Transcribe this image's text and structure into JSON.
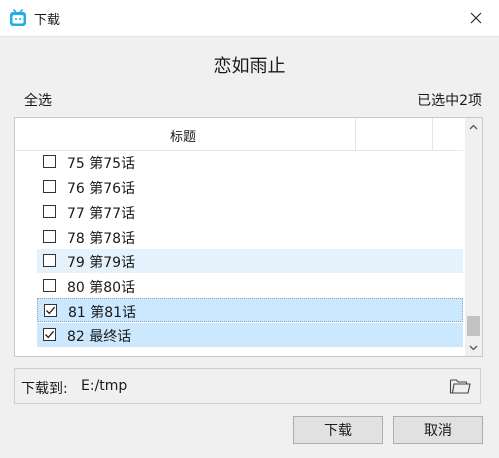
{
  "window": {
    "title": "下载",
    "icon": "bilibili-tv-icon",
    "accent": "#23ade5"
  },
  "heading": "恋如雨止",
  "toolbar": {
    "select_all": "全选",
    "selected_count": "已选中2项"
  },
  "list": {
    "column_title": "标题",
    "rows": [
      {
        "label": "75 第75话",
        "checked": false,
        "state": "normal"
      },
      {
        "label": "76 第76话",
        "checked": false,
        "state": "normal"
      },
      {
        "label": "77 第77话",
        "checked": false,
        "state": "normal"
      },
      {
        "label": "78 第78话",
        "checked": false,
        "state": "normal"
      },
      {
        "label": "79 第79话",
        "checked": false,
        "state": "hover"
      },
      {
        "label": "80 第80话",
        "checked": false,
        "state": "normal"
      },
      {
        "label": "81 第81话",
        "checked": true,
        "state": "selected-focused"
      },
      {
        "label": "82 最终话",
        "checked": true,
        "state": "selected"
      }
    ]
  },
  "path": {
    "label": "下载到:",
    "value": "E:/tmp"
  },
  "buttons": {
    "download": "下载",
    "cancel": "取消"
  },
  "colors": {
    "hover": "#e5f1fb",
    "selected": "#cce8ff",
    "button": "#e1e1e1"
  }
}
